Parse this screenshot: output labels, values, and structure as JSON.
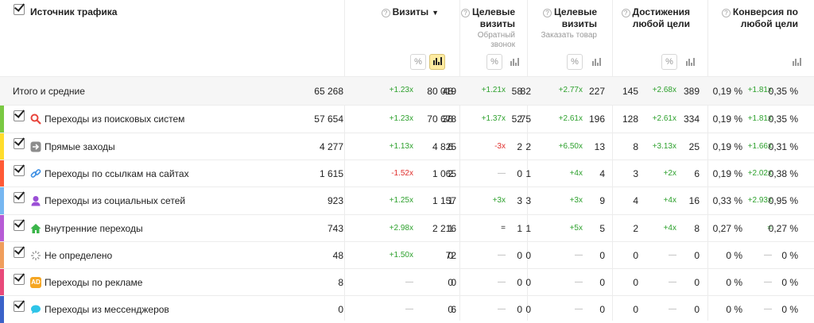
{
  "header": {
    "source_title": "Источник трафика",
    "metrics": [
      {
        "title_lines": [
          "Визиты"
        ],
        "sort_arrow": "▼",
        "sub": []
      },
      {
        "title_lines": [
          "Целевые",
          "визиты"
        ],
        "sub": [
          "Обратный",
          "звонок"
        ]
      },
      {
        "title_lines": [
          "Целевые",
          "визиты"
        ],
        "sub": [
          "Заказать товар"
        ]
      },
      {
        "title_lines": [
          "Достижения",
          "любой цели"
        ],
        "sub": []
      },
      {
        "title_lines": [
          "Конверсия по",
          "любой цели"
        ],
        "sub": []
      }
    ],
    "toggle_percent": "%",
    "help_glyph": "?"
  },
  "total_row": {
    "label": "Итого и средние",
    "cells": [
      [
        "65 268",
        "+1.23x",
        "80 019"
      ],
      [
        "48",
        "+1.21x",
        "58"
      ],
      [
        "82",
        "+2.77x",
        "227"
      ],
      [
        "145",
        "+2.68x",
        "389"
      ],
      [
        "0,19 %",
        "+1.81x",
        "0,35 %"
      ]
    ]
  },
  "rows": [
    {
      "label": "Переходы из поисковых систем",
      "color": "#7ac943",
      "icon": "search-icon",
      "cells": [
        [
          "57 654",
          "+1.23x",
          "70 678"
        ],
        [
          "38",
          "+1.37x",
          "52"
        ],
        [
          "75",
          "+2.61x",
          "196"
        ],
        [
          "128",
          "+2.61x",
          "334"
        ],
        [
          "0,19 %",
          "+1.81x",
          "0,35 %"
        ]
      ]
    },
    {
      "label": "Прямые заходы",
      "color": "#ffdd2c",
      "icon": "arrow-right-icon",
      "cells": [
        [
          "4 277",
          "+1.13x",
          "4 825"
        ],
        [
          "6",
          "-3x",
          "2"
        ],
        [
          "2",
          "+6.50x",
          "13"
        ],
        [
          "8",
          "+3.13x",
          "25"
        ],
        [
          "0,19 %",
          "+1.66x",
          "0,31 %"
        ]
      ]
    },
    {
      "label": "Переходы по ссылкам на сайтах",
      "color": "#ff5a36",
      "icon": "link-icon",
      "cells": [
        [
          "1 615",
          "-1.52x",
          "1 065"
        ],
        [
          "2",
          "—",
          "0"
        ],
        [
          "1",
          "+4x",
          "4"
        ],
        [
          "3",
          "+2x",
          "6"
        ],
        [
          "0,19 %",
          "+2.02x",
          "0,38 %"
        ]
      ]
    },
    {
      "label": "Переходы из социальных сетей",
      "color": "#77b7f1",
      "icon": "social-icon",
      "cells": [
        [
          "923",
          "+1.25x",
          "1 157"
        ],
        [
          "1",
          "+3x",
          "3"
        ],
        [
          "3",
          "+3x",
          "9"
        ],
        [
          "4",
          "+4x",
          "16"
        ],
        [
          "0,33 %",
          "+2.93x",
          "0,95 %"
        ]
      ]
    },
    {
      "label": "Внутренние переходы",
      "color": "#b75cd6",
      "icon": "home-icon",
      "cells": [
        [
          "743",
          "+2.98x",
          "2 216"
        ],
        [
          "1",
          "=",
          "1"
        ],
        [
          "1",
          "+5x",
          "5"
        ],
        [
          "2",
          "+4x",
          "8"
        ],
        [
          "0,27 %",
          "≈",
          "0,27 %"
        ]
      ]
    },
    {
      "label": "Не определено",
      "color": "#f09e5c",
      "icon": "loading-icon",
      "cells": [
        [
          "48",
          "+1.50x",
          "72"
        ],
        [
          "0",
          "—",
          "0"
        ],
        [
          "0",
          "—",
          "0"
        ],
        [
          "0",
          "—",
          "0"
        ],
        [
          "0 %",
          "—",
          "0 %"
        ]
      ]
    },
    {
      "label": "Переходы по рекламе",
      "color": "#e84a7a",
      "icon": "ad-icon",
      "icon_text": "AD",
      "cells": [
        [
          "8",
          "—",
          "0"
        ],
        [
          "0",
          "—",
          "0"
        ],
        [
          "0",
          "—",
          "0"
        ],
        [
          "0",
          "—",
          "0"
        ],
        [
          "0 %",
          "—",
          "0 %"
        ]
      ]
    },
    {
      "label": "Переходы из мессенджеров",
      "color": "#3b62c9",
      "icon": "messenger-icon",
      "cells": [
        [
          "0",
          "—",
          "6"
        ],
        [
          "0",
          "—",
          "0"
        ],
        [
          "0",
          "—",
          "0"
        ],
        [
          "0",
          "—",
          "0"
        ],
        [
          "0 %",
          "—",
          "0 %"
        ]
      ]
    }
  ]
}
